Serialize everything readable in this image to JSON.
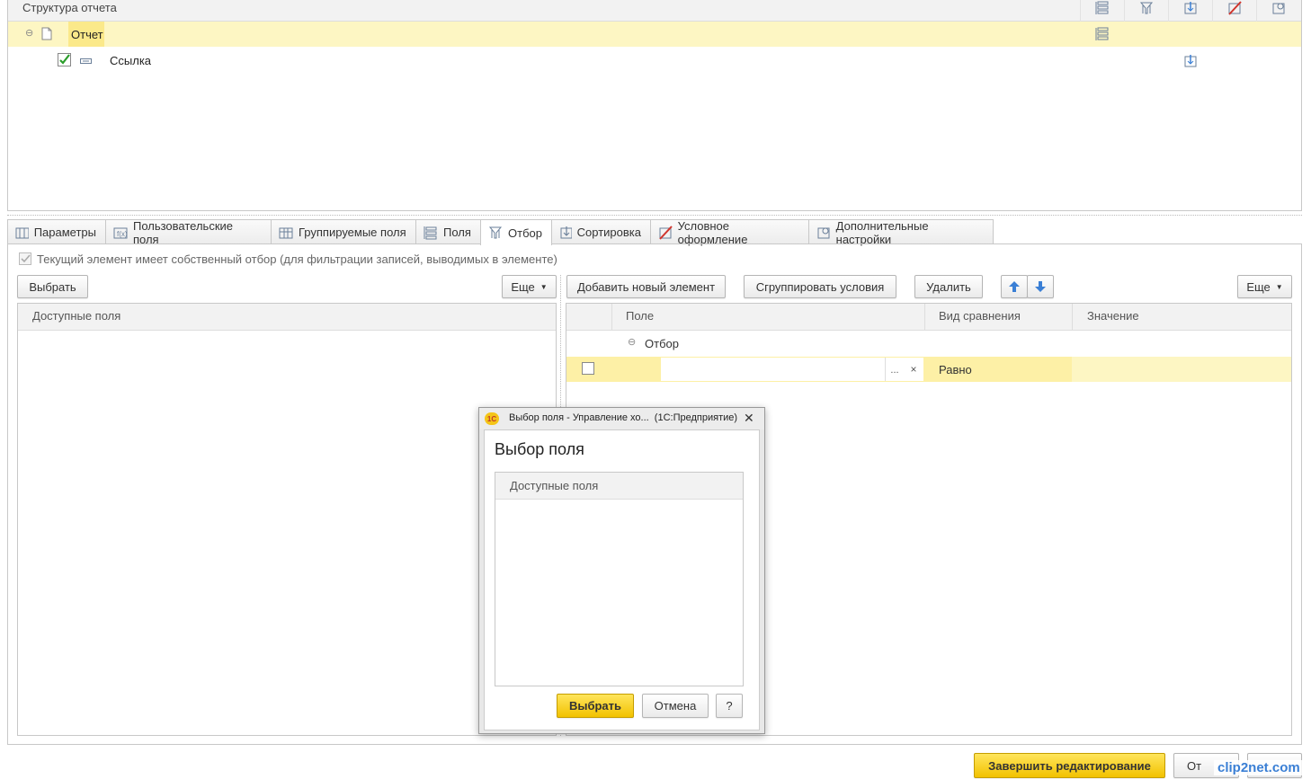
{
  "structure": {
    "header": "Структура отчета",
    "rows": [
      {
        "label": "Отчет"
      },
      {
        "label": "Ссылка"
      }
    ]
  },
  "tabs": [
    {
      "label": "Параметры"
    },
    {
      "label": "Пользовательские поля"
    },
    {
      "label": "Группируемые поля"
    },
    {
      "label": "Поля"
    },
    {
      "label": "Отбор"
    },
    {
      "label": "Сортировка"
    },
    {
      "label": "Условное оформление"
    },
    {
      "label": "Дополнительные настройки"
    }
  ],
  "filter": {
    "own_filter_label": "Текущий элемент имеет собственный отбор (для фильтрации записей, выводимых в элементе)",
    "left": {
      "select_button": "Выбрать",
      "more_button": "Еще",
      "column_header": "Доступные поля"
    },
    "right": {
      "add_button": "Добавить новый элемент",
      "group_button": "Сгруппировать условия",
      "delete_button": "Удалить",
      "more_button": "Еще",
      "columns": [
        "Поле",
        "Вид сравнения",
        "Значение"
      ],
      "group_row": "Отбор",
      "condition": {
        "field_value": "",
        "ellipsis": "...",
        "clear": "×",
        "comparison": "Равно",
        "value": ""
      }
    }
  },
  "dialog": {
    "window_title": "Выбор поля - Управление хо...  (1С:Предприятие)",
    "logo": "1С",
    "title": "Выбор поля",
    "column_header": "Доступные поля",
    "ok_button": "Выбрать",
    "cancel_button": "Отмена",
    "help_button": "?",
    "close": "✕"
  },
  "footer": {
    "finish_button": "Завершить редактирование",
    "cancel_button_partial": "От",
    "watermark": "clip2net.com"
  },
  "colors": {
    "highlight_row": "#fdf6c3",
    "yellow_button": "#f2c200",
    "arrow_blue": "#3a7fd5",
    "check_green": "#2a9d2a"
  }
}
